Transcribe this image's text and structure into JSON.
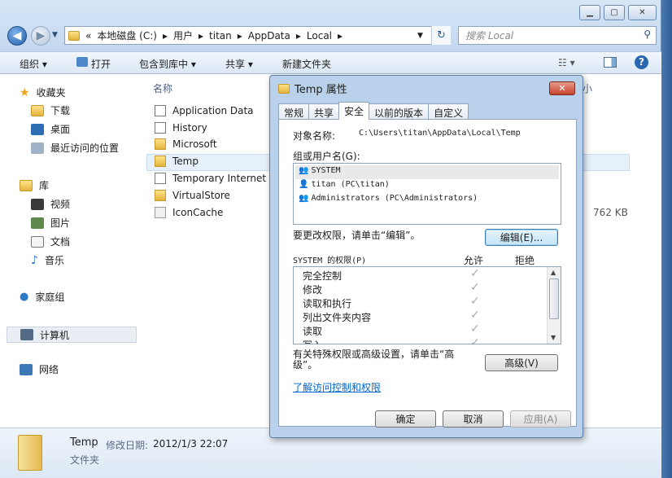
{
  "explorer": {
    "address": [
      "«",
      "本地磁盘 (C:)",
      "▸",
      "用户",
      "▸",
      "titan",
      "▸",
      "AppData",
      "▸",
      "Local",
      "▸"
    ],
    "search_placeholder": "搜索 Local",
    "toolbar": {
      "organize": "组织 ▾",
      "open": "打开",
      "include": "包含到库中 ▾",
      "share": "共享 ▾",
      "new_folder": "新建文件夹"
    },
    "column_name": "名称",
    "column_size": "小",
    "nav": {
      "favorites": "收藏夹",
      "downloads": "下载",
      "desktop": "桌面",
      "recent": "最近访问的位置",
      "libraries": "库",
      "videos": "视频",
      "pictures": "图片",
      "documents": "文档",
      "music": "音乐",
      "homegroup": "家庭组",
      "computer": "计算机",
      "network": "网络"
    },
    "files": [
      {
        "name": "Application Data",
        "type": "link"
      },
      {
        "name": "History",
        "type": "link"
      },
      {
        "name": "Microsoft",
        "type": "folder"
      },
      {
        "name": "Temp",
        "type": "folder"
      },
      {
        "name": "Temporary Internet",
        "type": "link"
      },
      {
        "name": "VirtualStore",
        "type": "folder"
      },
      {
        "name": "IconCache",
        "type": "file"
      }
    ],
    "iconcache_size": "762 KB",
    "details": {
      "name": "Temp",
      "modified_label": "修改日期:",
      "modified": "2012/1/3 22:07",
      "type": "文件夹"
    }
  },
  "dialog": {
    "title": "Temp 属性",
    "tabs": [
      "常规",
      "共享",
      "安全",
      "以前的版本",
      "自定义"
    ],
    "active_tab": "安全",
    "object_label": "对象名称:",
    "object_value": "C:\\Users\\titan\\AppData\\Local\\Temp",
    "group_label": "组或用户名(G):",
    "users": [
      "SYSTEM",
      "titan (PC\\titan)",
      "Administrators (PC\\Administrators)"
    ],
    "edit_hint": "要更改权限，请单击“编辑”。",
    "edit_button": "编辑(E)...",
    "perm_header": "SYSTEM 的权限(P)",
    "allow_header": "允许",
    "deny_header": "拒绝",
    "permissions": [
      "完全控制",
      "修改",
      "读取和执行",
      "列出文件夹内容",
      "读取",
      "写入"
    ],
    "advanced_hint": "有关特殊权限或高级设置，请单击“高级”。",
    "advanced_button": "高级(V)",
    "link": "了解访问控制和权限",
    "ok": "确定",
    "cancel": "取消",
    "apply": "应用(A)"
  }
}
